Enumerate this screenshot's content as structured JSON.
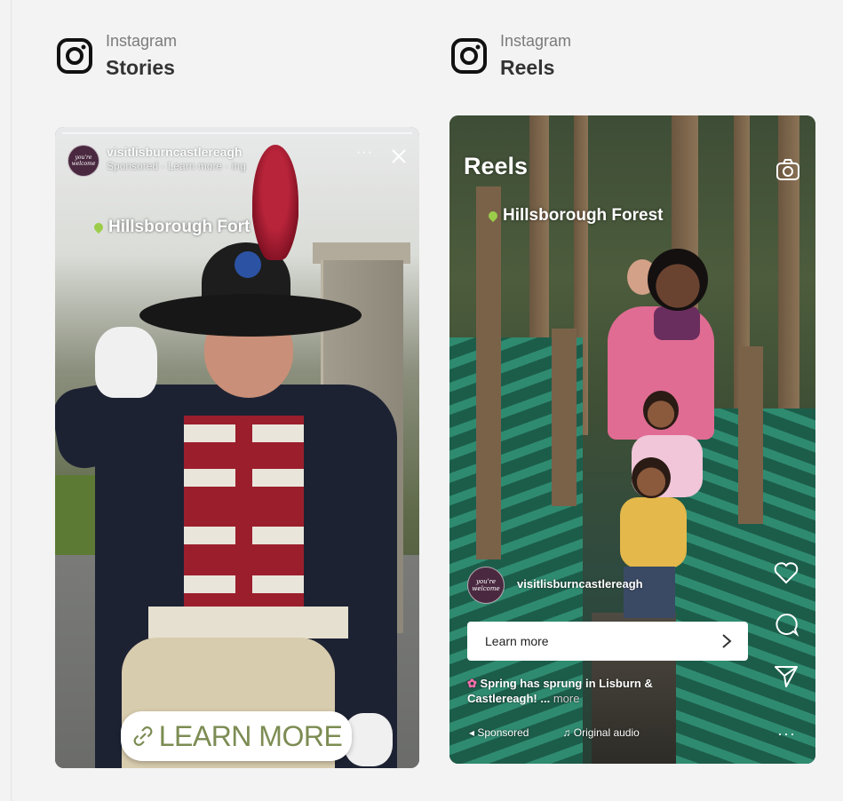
{
  "placements": {
    "stories": {
      "platform": "Instagram",
      "title": "Stories"
    },
    "reels": {
      "platform": "Instagram",
      "title": "Reels"
    }
  },
  "stories": {
    "username": "visitlisburncastlereagh",
    "subline": "Sponsored · Learn more · ing",
    "more": "···",
    "location": "Hillsborough Fort",
    "cta": "LEARN MORE",
    "avatar_text": "you're welcome"
  },
  "reels": {
    "header_title": "Reels",
    "location": "Hillsborough Forest",
    "username": "visitlisburncastlereagh",
    "avatar_text": "you're welcome",
    "cta_label": "Learn more",
    "caption": "Spring has sprung in Lisburn & Castlereagh! ...",
    "caption_more": "more",
    "sponsored_label": "Sponsored",
    "audio_label": "Original audio",
    "more": "···"
  },
  "colors": {
    "background": "#f3f3f3",
    "sticker_text": "#7c8c53",
    "location_pin": "#9ccd4a"
  },
  "icons": [
    "instagram-logo-icon",
    "link-icon",
    "close-icon",
    "camera-icon",
    "heart-icon",
    "comment-icon",
    "share-icon",
    "chevron-right-icon",
    "music-note-icon",
    "megaphone-icon"
  ]
}
